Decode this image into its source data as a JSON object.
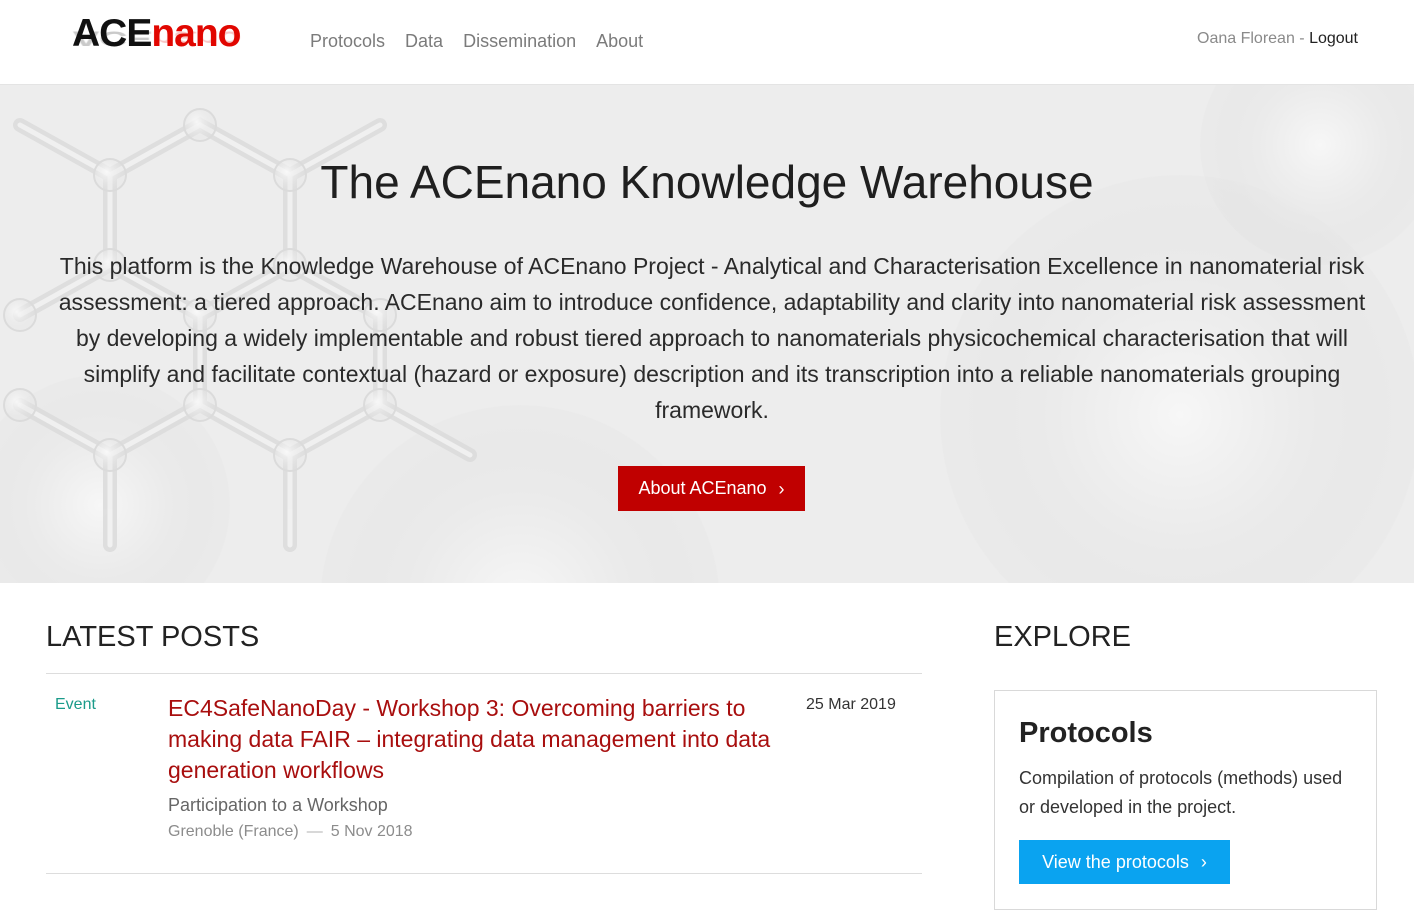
{
  "brand": {
    "logo_ace": "ACE",
    "logo_nano": "nano",
    "ace_color": "#111111",
    "nano_color": "#e10600"
  },
  "nav": {
    "items": [
      {
        "label": "Protocols"
      },
      {
        "label": "Data"
      },
      {
        "label": "Dissemination"
      },
      {
        "label": "About"
      }
    ]
  },
  "user": {
    "name": "Oana Florean",
    "separator": " - ",
    "logout_label": "Logout"
  },
  "hero": {
    "title": "The ACEnano Knowledge Warehouse",
    "description": "This platform is the Knowledge Warehouse of ACEnano Project - Analytical and Characterisation Excellence in nanomaterial risk assessment: a tiered approach. ACEnano aim to introduce confidence, adaptability and clarity into nanomaterial risk assessment by developing a widely implementable and robust tiered approach to nanomaterials physicochemical characterisation that will simplify and facilitate contextual (hazard or exposure) description and its transcription into a reliable nanomaterials grouping framework.",
    "button_label": "About ACEnano",
    "button_icon": "chevron-right-icon",
    "button_color": "#c00000"
  },
  "latest_posts": {
    "heading": "LATEST POSTS",
    "posts": [
      {
        "category": "Event",
        "title": "EC4SafeNanoDay - Workshop 3: Overcoming barriers to making data FAIR – integrating data management into data generation workflows",
        "date": "25 Mar 2019",
        "subtitle": "Participation to a Workshop",
        "location": "Grenoble (France)",
        "meta_separator": "—",
        "event_date": "5 Nov 2018"
      }
    ]
  },
  "explore": {
    "heading": "EXPLORE",
    "cards": [
      {
        "title": "Protocols",
        "text": "Compilation of protocols (methods) used or developed in the project.",
        "button_label": "View the protocols",
        "button_icon": "chevron-right-icon",
        "button_color": "#0aa3f0"
      }
    ]
  }
}
